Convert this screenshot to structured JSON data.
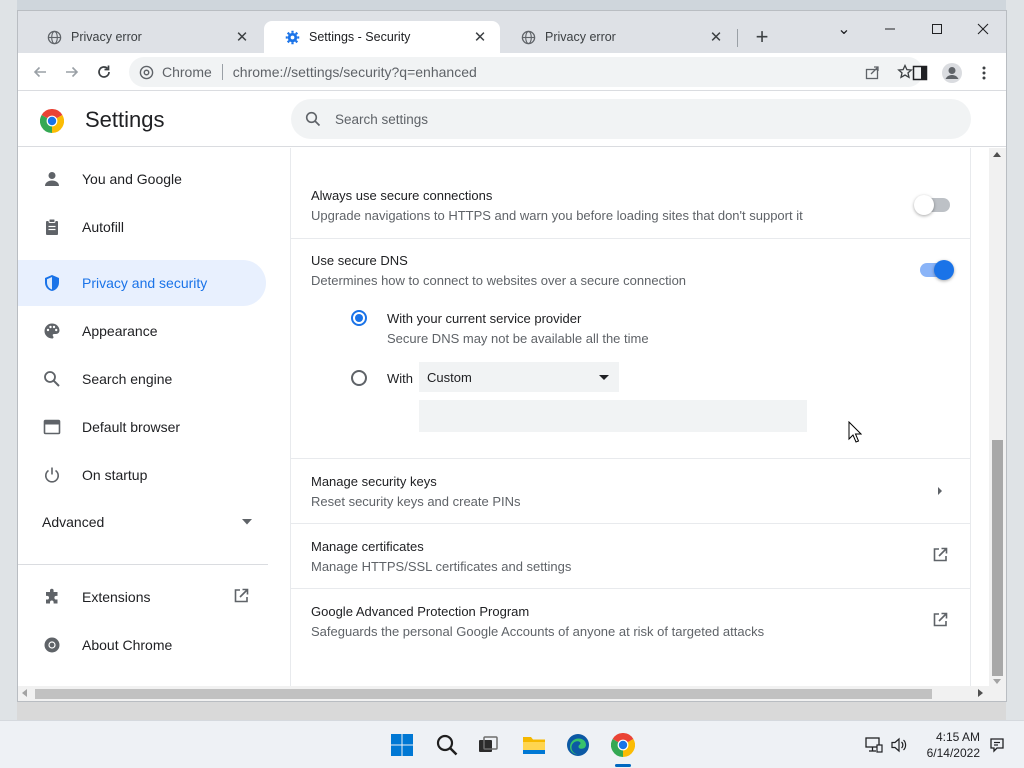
{
  "browser": {
    "tabs": [
      {
        "title": "Privacy error",
        "close": "✕"
      },
      {
        "title": "Settings - Security",
        "close": "✕"
      },
      {
        "title": "Privacy error",
        "close": "✕"
      }
    ],
    "new_tab": "+",
    "window_controls": {
      "dropdown": "⌄",
      "minimize": "—",
      "maximize": "☐",
      "close": "✕"
    }
  },
  "toolbar": {
    "site_name": "Chrome",
    "url": "chrome://settings/security?q=enhanced"
  },
  "header": {
    "title": "Settings",
    "search_placeholder": "Search settings"
  },
  "sidebar": {
    "items": [
      {
        "label": "You and Google",
        "icon": "person-icon"
      },
      {
        "label": "Autofill",
        "icon": "clipboard-icon"
      },
      {
        "label": "Privacy and security",
        "icon": "shield-icon",
        "active": true
      },
      {
        "label": "Appearance",
        "icon": "palette-icon"
      },
      {
        "label": "Search engine",
        "icon": "search-icon"
      },
      {
        "label": "Default browser",
        "icon": "browser-icon"
      },
      {
        "label": "On startup",
        "icon": "power-icon"
      }
    ],
    "advanced": "Advanced",
    "extensions": "Extensions",
    "about": "About Chrome"
  },
  "main": {
    "always_secure": {
      "title": "Always use secure connections",
      "subtitle": "Upgrade navigations to HTTPS and warn you before loading sites that don't support it",
      "enabled": false
    },
    "secure_dns": {
      "title": "Use secure DNS",
      "subtitle": "Determines how to connect to websites over a secure connection",
      "enabled": true,
      "option_current": {
        "label": "With your current service provider",
        "sublabel": "Secure DNS may not be available all the time",
        "selected": true
      },
      "option_custom": {
        "label": "With",
        "select_value": "Custom",
        "selected": false
      }
    },
    "security_keys": {
      "title": "Manage security keys",
      "subtitle": "Reset security keys and create PINs"
    },
    "certificates": {
      "title": "Manage certificates",
      "subtitle": "Manage HTTPS/SSL certificates and settings"
    },
    "advanced_protection": {
      "title": "Google Advanced Protection Program",
      "subtitle": "Safeguards the personal Google Accounts of anyone at risk of targeted attacks"
    }
  },
  "taskbar": {
    "time": "4:15 AM",
    "date": "6/14/2022"
  },
  "colors": {
    "accent": "#1a73e8",
    "active_nav_bg": "#e8f0fe",
    "toggle_on_track": "#8ab4f8",
    "toggle_off_track": "#bdc1c6"
  }
}
